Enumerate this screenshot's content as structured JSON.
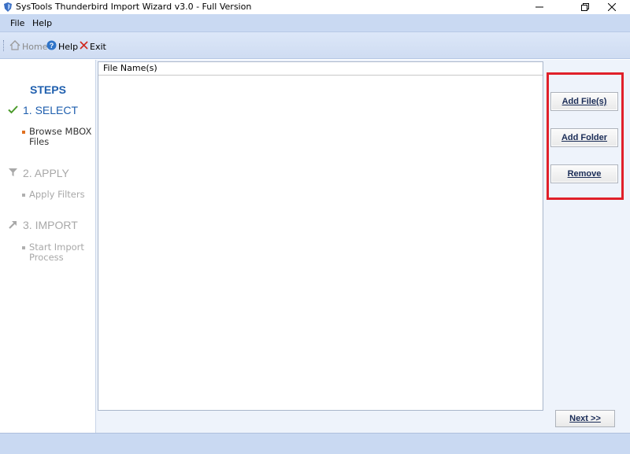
{
  "window": {
    "title": "SysTools Thunderbird Import Wizard v3.0 - Full Version",
    "controls": [
      "minimize-icon",
      "restore-icon",
      "close-icon"
    ]
  },
  "menu": {
    "items": [
      {
        "label": "File"
      },
      {
        "label": "Help"
      }
    ]
  },
  "toolbar": {
    "home_label": "Home",
    "help_label": "Help",
    "exit_label": "Exit"
  },
  "steps": {
    "title": "STEPS",
    "items": [
      {
        "label": "1. SELECT",
        "icon": "checkmark-icon",
        "state": "active",
        "sub": "Browse MBOX Files"
      },
      {
        "label": "2. APPLY",
        "icon": "filter-icon",
        "state": "inactive",
        "sub": "Apply Filters"
      },
      {
        "label": "3. IMPORT",
        "icon": "import-arrow-icon",
        "state": "inactive",
        "sub": "Start Import Process"
      }
    ]
  },
  "file_list": {
    "column_header": "File Name(s)",
    "rows": []
  },
  "actions": {
    "add_files": "Add File(s)",
    "add_folder": "Add Folder",
    "remove": "Remove"
  },
  "footer": {
    "next_label": "Next >>"
  },
  "colors": {
    "accent": "#1f5fae",
    "highlight_border": "#e0202a",
    "bar_background": "#c9d9f2"
  }
}
